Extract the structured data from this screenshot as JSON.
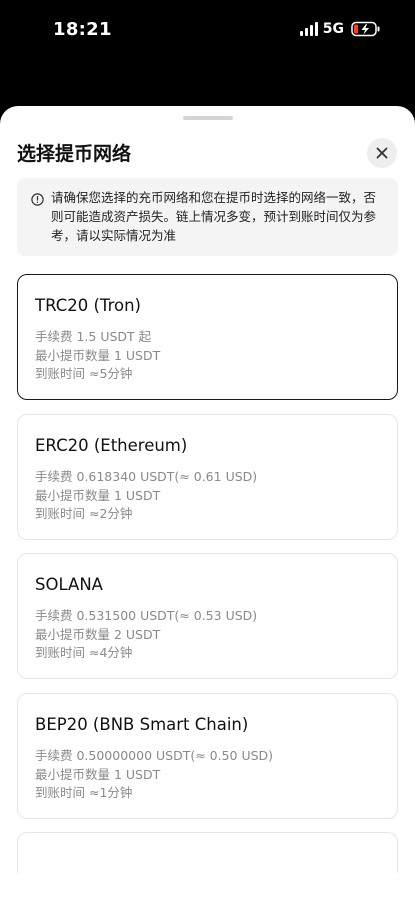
{
  "status_bar": {
    "time": "18:21",
    "network": "5G"
  },
  "sheet": {
    "title": "选择提币网络",
    "notice": "请确保您选择的充币网络和您在提币时选择的网络一致，否则可能造成资产损失。链上情况多变，预计到账时间仅为参考，请以实际情况为准",
    "networks": [
      {
        "name": "TRC20 (Tron)",
        "fee": "手续费 1.5 USDT 起",
        "min": "最小提币数量 1 USDT",
        "arrival": "到账时间 ≈5分钟",
        "selected": true
      },
      {
        "name": "ERC20 (Ethereum)",
        "fee": "手续费 0.618340 USDT(≈ 0.61 USD)",
        "min": "最小提币数量 1 USDT",
        "arrival": "到账时间 ≈2分钟",
        "selected": false
      },
      {
        "name": "SOLANA",
        "fee": "手续费 0.531500 USDT(≈ 0.53 USD)",
        "min": "最小提币数量 2 USDT",
        "arrival": "到账时间 ≈4分钟",
        "selected": false
      },
      {
        "name": "BEP20 (BNB Smart Chain)",
        "fee": "手续费 0.50000000 USDT(≈ 0.50 USD)",
        "min": "最小提币数量 1 USDT",
        "arrival": "到账时间 ≈1分钟",
        "selected": false
      }
    ]
  },
  "icons": {
    "close": "close-icon",
    "info": "info-icon",
    "signal": "signal-icon",
    "battery": "battery-charging-icon"
  },
  "colors": {
    "sheet_bg": "#ffffff",
    "notice_bg": "#f4f4f4",
    "selected_border": "#1a1a1a",
    "card_border": "#e6e6e6",
    "battery_accent": "#ff3b30"
  }
}
